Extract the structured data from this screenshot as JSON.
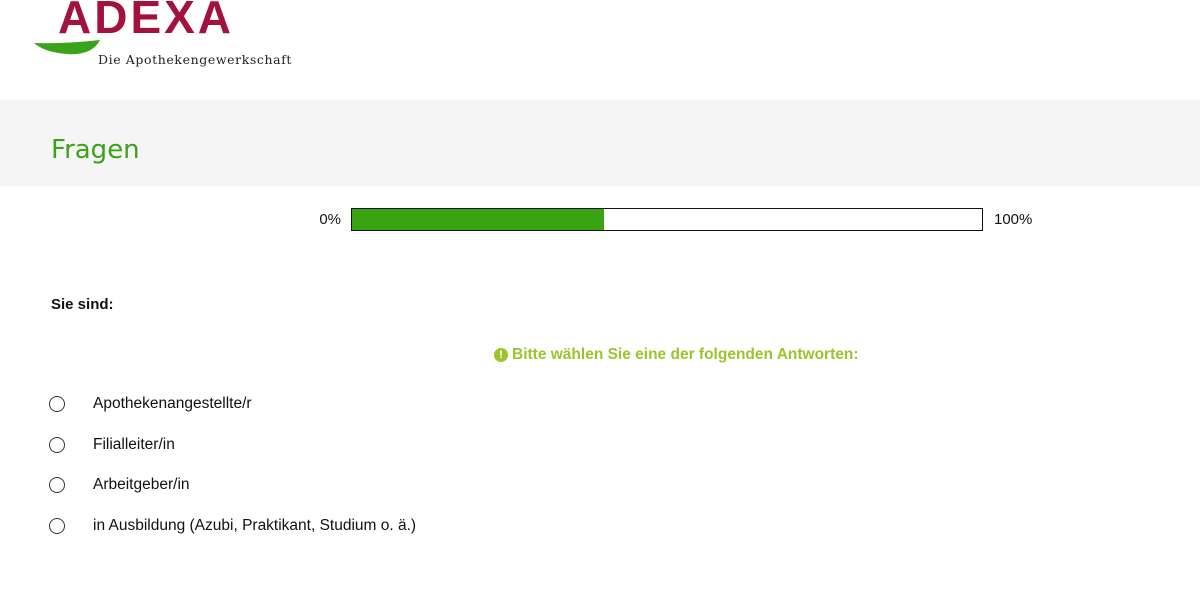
{
  "colors": {
    "brand_red": "#a3123f",
    "brand_green": "#3aa31a",
    "progress_green": "#3aa312",
    "hint_green": "#9cc42b",
    "title_green": "#3aa31a"
  },
  "logo": {
    "wordmark": "ADEXA",
    "tagline": "Die Apothekengewerkschaft"
  },
  "header": {
    "title": "Fragen"
  },
  "progress": {
    "min_label": "0%",
    "max_label": "100%",
    "value_percent": 40
  },
  "question": {
    "label": "Sie sind:",
    "hint_icon": "exclamation-circle-icon",
    "hint": "Bitte wählen Sie eine der folgenden Antworten:",
    "options": [
      {
        "label": "Apothekenangestellte/r",
        "selected": false
      },
      {
        "label": "Filialleiter/in",
        "selected": false
      },
      {
        "label": "Arbeitgeber/in",
        "selected": false
      },
      {
        "label": "in Ausbildung (Azubi, Praktikant, Studium o. ä.)",
        "selected": false
      }
    ]
  }
}
